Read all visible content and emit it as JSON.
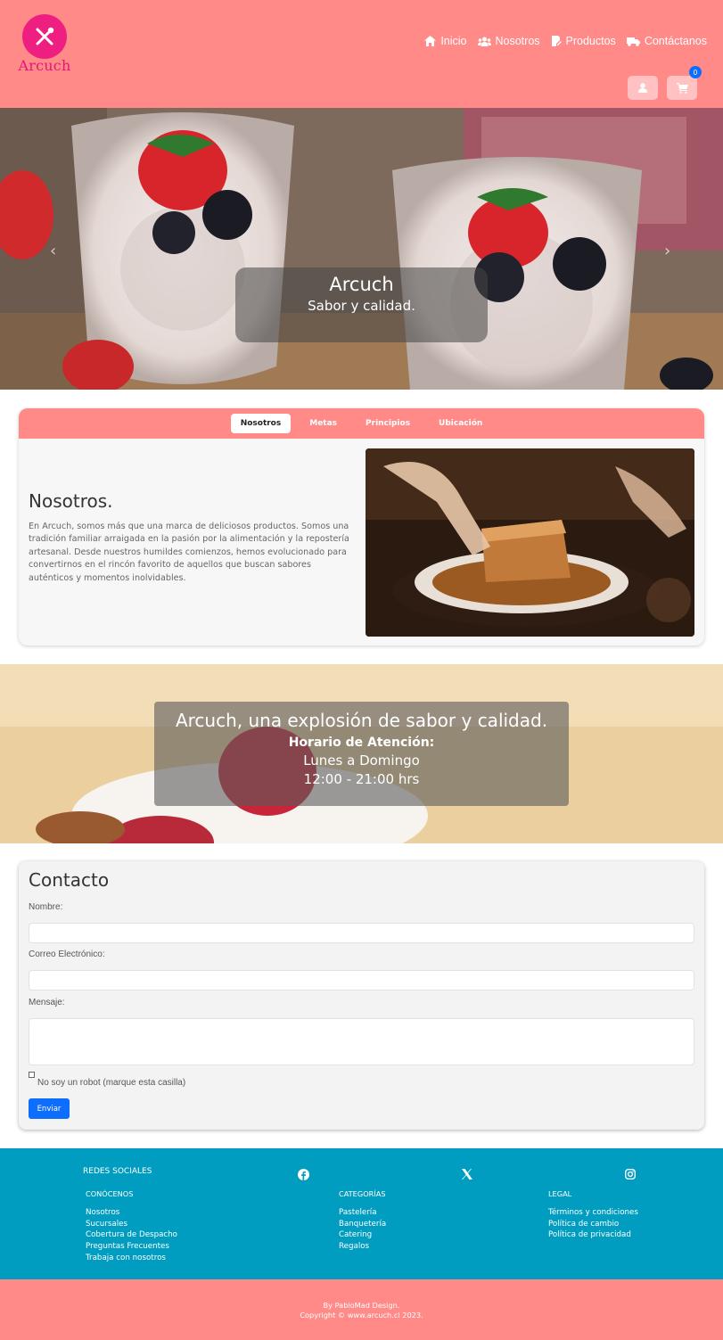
{
  "header": {
    "logo_text": "Arcuch",
    "nav": [
      {
        "label": "Inicio",
        "icon": "home-icon"
      },
      {
        "label": "Nosotros",
        "icon": "users-icon"
      },
      {
        "label": "Productos",
        "icon": "menu-edit-icon"
      },
      {
        "label": "Contáctanos",
        "icon": "truck-icon"
      }
    ],
    "cart_count": "0"
  },
  "hero": {
    "title": "Arcuch",
    "subtitle": "Sabor y calidad."
  },
  "tabs": {
    "items": [
      "Nosotros",
      "Metas",
      "Principios",
      "Ubicación"
    ],
    "active": "Nosotros"
  },
  "about": {
    "title": "Nosotros.",
    "text": "En Arcuch, somos más que una marca de deliciosos productos. Somos una tradición familiar arraigada en la pasión por la alimentación y la repostería artesanal. Desde nuestros humildes comienzos, hemos evolucionado para convertirnos en el rincón favorito de aquellos que buscan sabores auténticos y momentos inolvidables."
  },
  "banner": {
    "headline": "Arcuch, una explosión de sabor y calidad.",
    "hours_title": "Horario de Atención:",
    "days": "Lunes a Domingo",
    "hours": "12:00 - 21:00 hrs"
  },
  "contact": {
    "title": "Contacto",
    "name_label": "Nombre:",
    "email_label": "Correo Electrónico:",
    "message_label": "Mensaje:",
    "robot_label": "No soy un robot (marque esta casilla)",
    "send_label": "Enviar"
  },
  "footer": {
    "social_title": "REDES SOCIALES",
    "social_icons": [
      "facebook-icon",
      "x-icon",
      "instagram-icon"
    ],
    "columns": [
      {
        "title": "CONÓCENOS",
        "links": [
          "Nosotros",
          "Sucursales",
          "Cobertura de Despacho",
          "Preguntas Frecuentes",
          "Trabaja con nosotros"
        ]
      },
      {
        "title": "CATEGORÍAS",
        "links": [
          "Pastelería",
          "Banquetería",
          "Catering",
          "Regalos"
        ]
      },
      {
        "title": "LEGAL",
        "links": [
          "Términos y condiciones",
          "Política de cambio",
          "Política de privacidad"
        ]
      }
    ],
    "credit": "By PabloMad Design.",
    "copyright": "Copyright © www.arcuch.cl 2023."
  }
}
